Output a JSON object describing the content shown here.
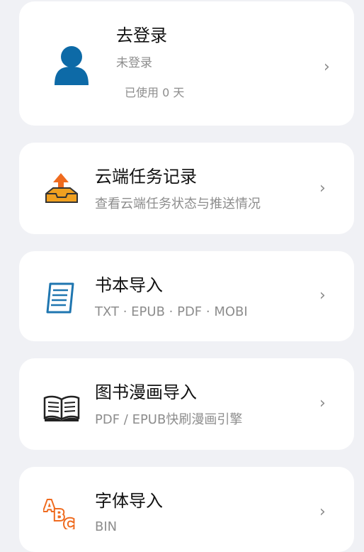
{
  "login": {
    "title": "去登录",
    "status": "未登录",
    "usage": "已使用 0 天",
    "avatar_icon": "user-avatar-icon",
    "chevron": "›"
  },
  "menu": {
    "items": [
      {
        "title": "云端任务记录",
        "subtitle": "查看云端任务状态与推送情况",
        "icon": "cloud-upload-tray-icon",
        "chevron": "›"
      },
      {
        "title": "书本导入",
        "subtitle": "TXT · EPUB · PDF · MOBI",
        "icon": "document-icon",
        "chevron": "›"
      },
      {
        "title": "图书漫画导入",
        "subtitle": "PDF / EPUB快刷漫画引擎",
        "icon": "open-book-icon",
        "chevron": "›"
      },
      {
        "title": "字体导入",
        "subtitle": "BIN",
        "icon": "abc-font-icon",
        "chevron": "›"
      }
    ]
  },
  "colors": {
    "avatar": "#0d6aa7",
    "tray": "#f0a020",
    "arrow": "#ef6b1f",
    "doc": "#1f76b0"
  }
}
